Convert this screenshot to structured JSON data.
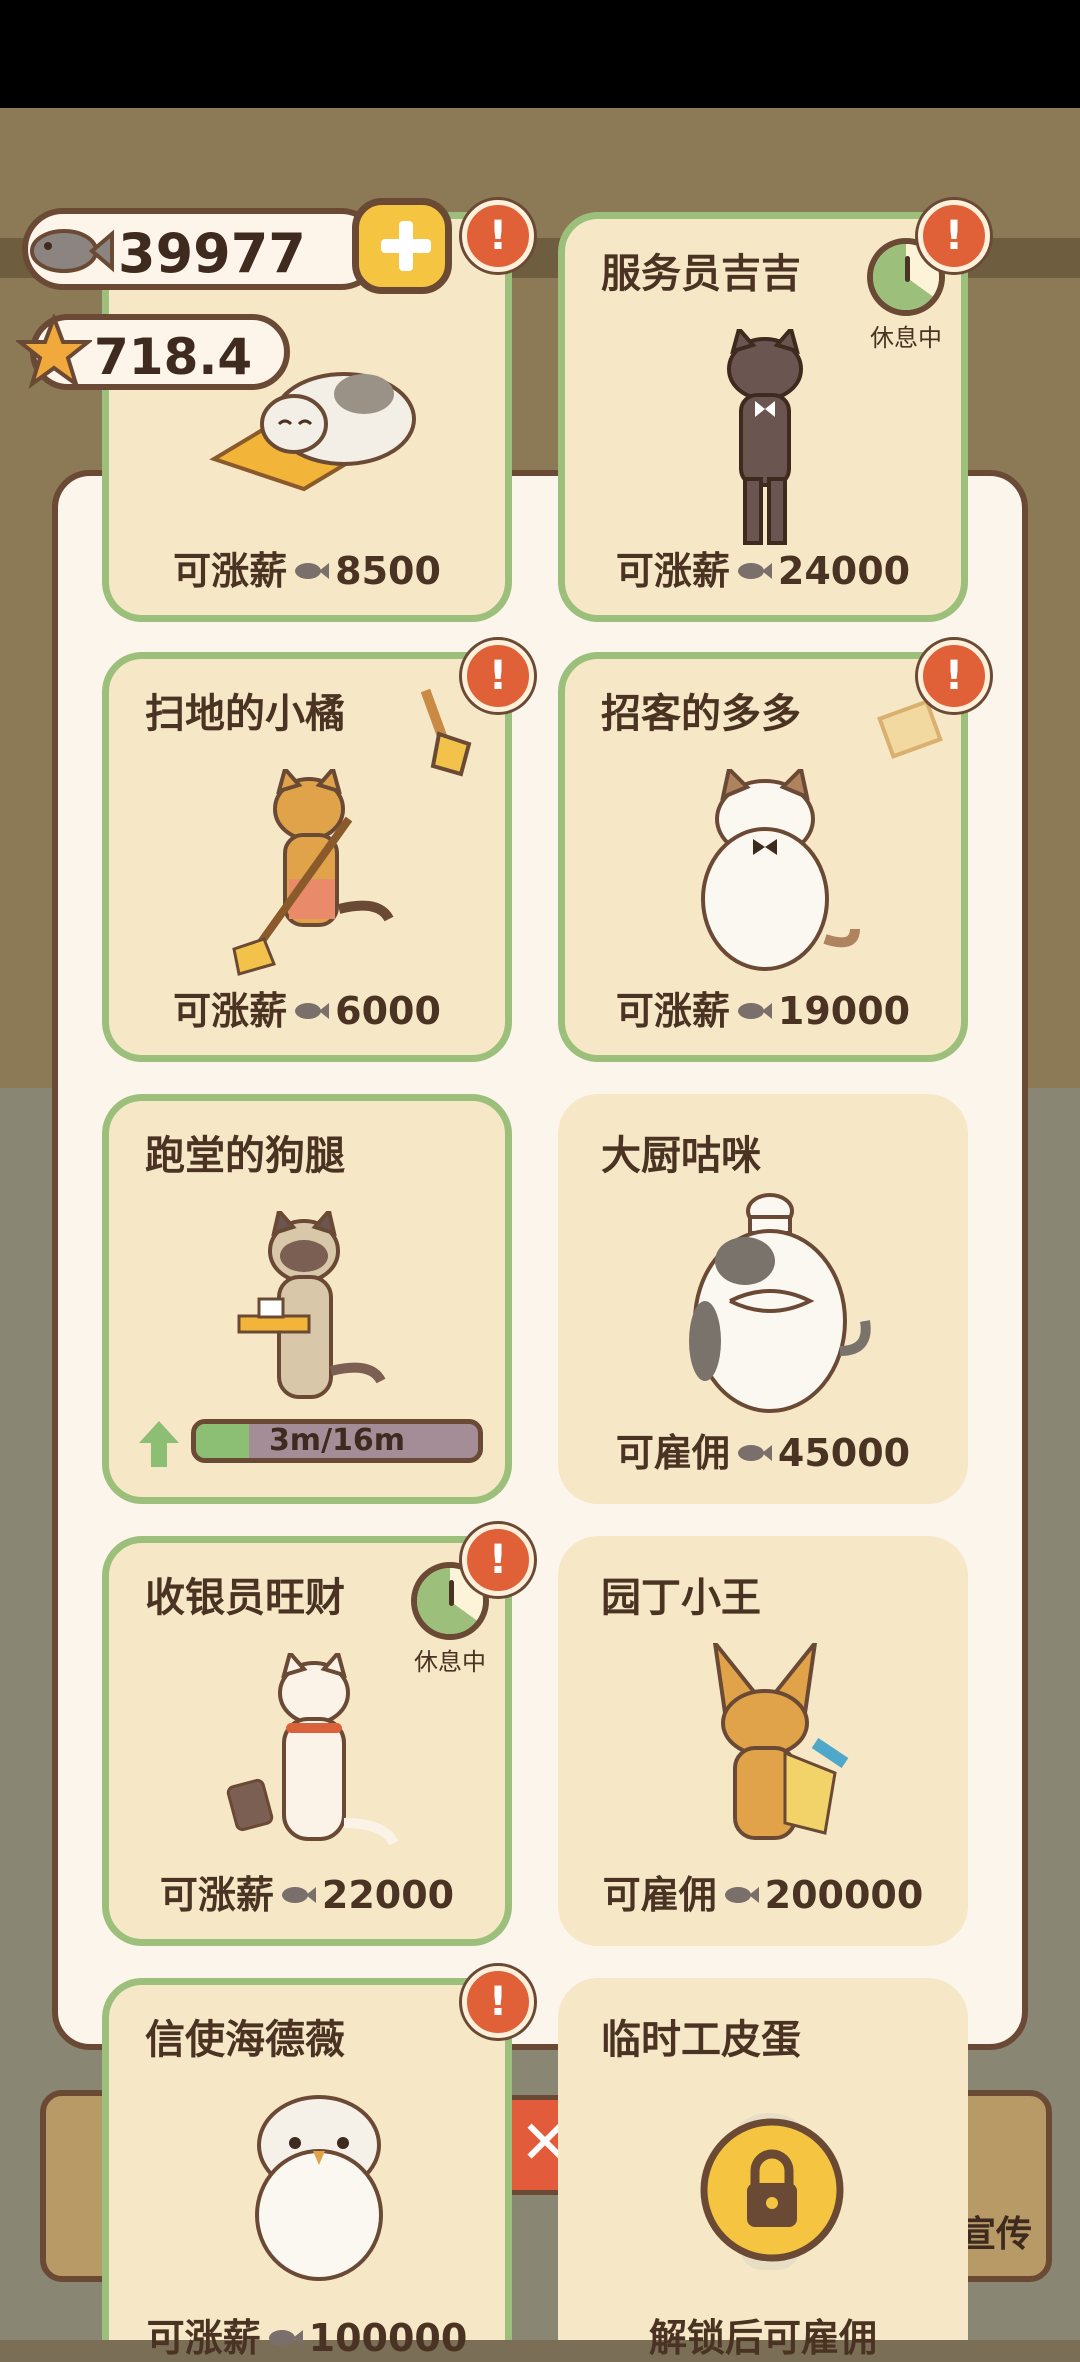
{
  "currency": {
    "fish": "39977",
    "stars": "718.4"
  },
  "labels": {
    "resting": "休息中",
    "raise": "可涨薪",
    "hire": "可雇佣",
    "unlock_hint": "解锁后可雇佣",
    "side_button": "宣传"
  },
  "staff": [
    {
      "name": "",
      "action": "可涨薪",
      "cost": "8500",
      "badge": "!",
      "state": "raise"
    },
    {
      "name": "服务员吉吉",
      "action": "可涨薪",
      "cost": "24000",
      "badge": "!",
      "status": "休息中"
    },
    {
      "name": "扫地的小橘",
      "action": "可涨薪",
      "cost": "6000",
      "badge": "!"
    },
    {
      "name": "招客的多多",
      "action": "可涨薪",
      "cost": "19000",
      "badge": "!"
    },
    {
      "name": "跑堂的狗腿",
      "progress_label": "3m/16m",
      "progress_fraction": 0.1875
    },
    {
      "name": "大厨咕咪",
      "action": "可雇佣",
      "cost": "45000"
    },
    {
      "name": "收银员旺财",
      "action": "可涨薪",
      "cost": "22000",
      "badge": "!",
      "status": "休息中"
    },
    {
      "name": "园丁小王",
      "action": "可雇佣",
      "cost": "200000"
    },
    {
      "name": "信使海德薇",
      "action": "可涨薪",
      "cost": "100000",
      "badge": "!"
    },
    {
      "name": "临时工皮蛋",
      "action": "解锁后可雇佣",
      "locked": true
    }
  ],
  "colors": {
    "card_bg": "#f6e8c6",
    "card_border_active": "#9cc07b",
    "badge": "#e06137",
    "brown_outline": "#6b4a35"
  }
}
